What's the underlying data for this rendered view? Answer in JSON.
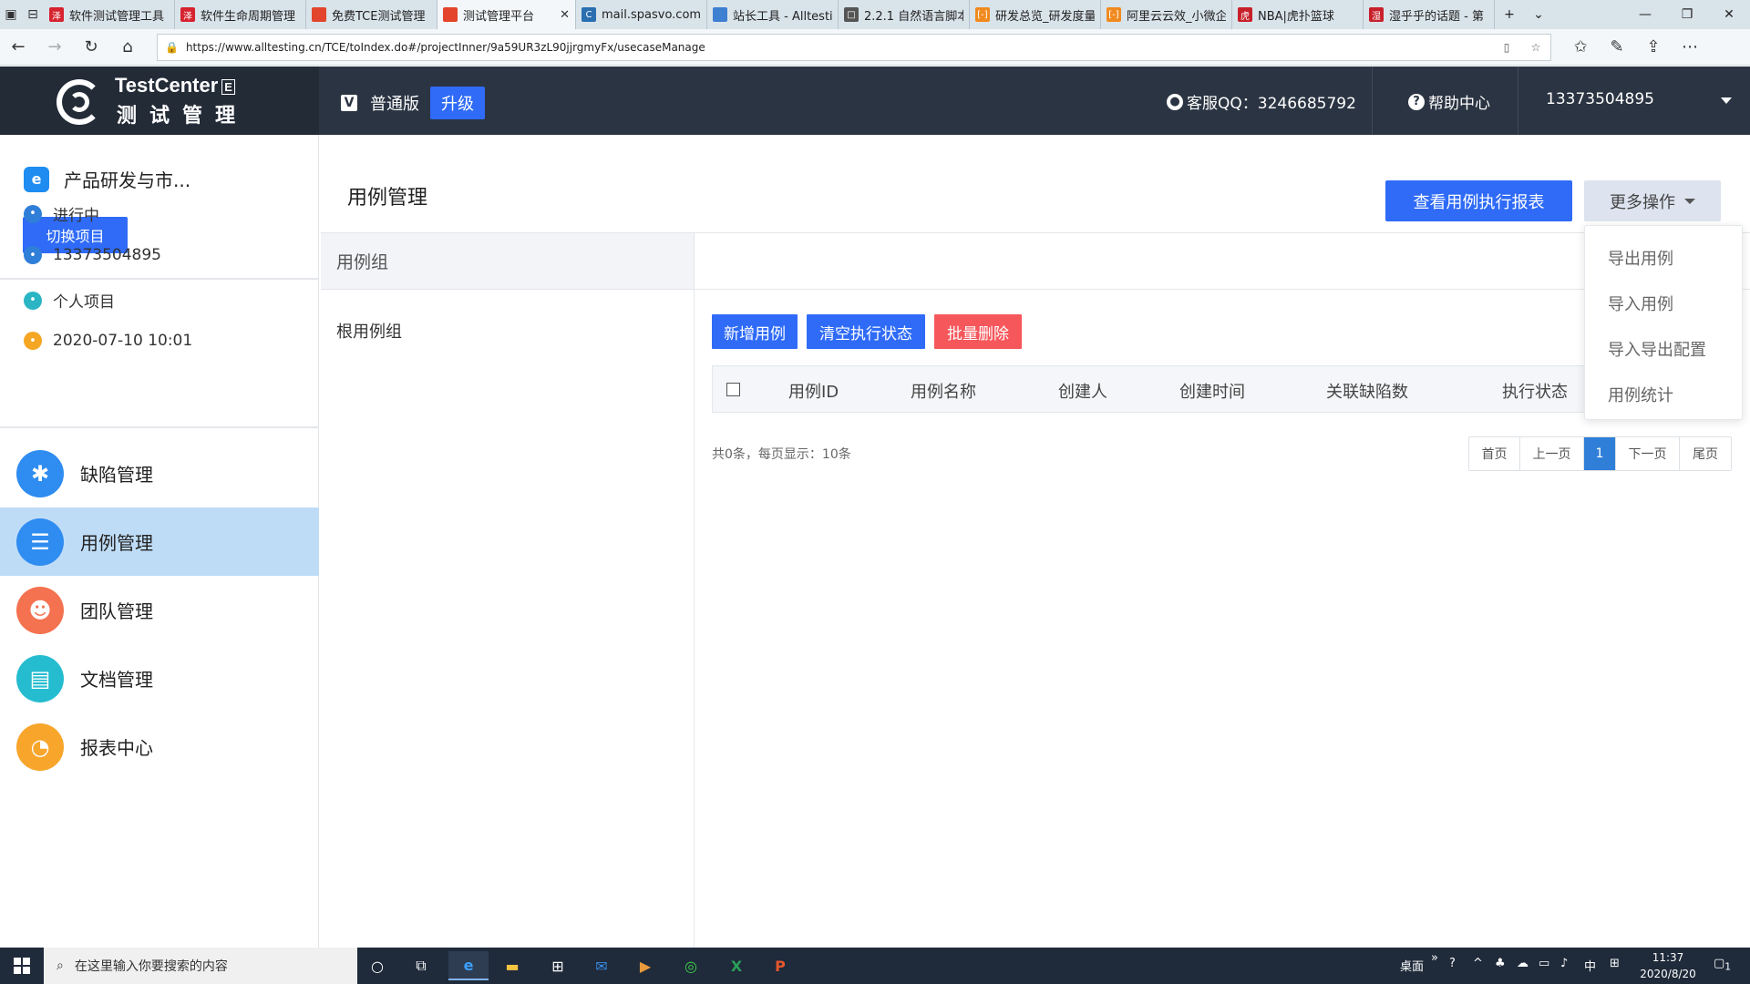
{
  "browser": {
    "tabs": [
      {
        "title": "软件测试管理工具",
        "fav": "泽",
        "color": "#d6232f"
      },
      {
        "title": "软件生命周期管理",
        "fav": "泽",
        "color": "#d6232f"
      },
      {
        "title": "免费TCE测试管理",
        "fav": "",
        "color": "#e2452b"
      },
      {
        "title": "测试管理平台",
        "fav": "",
        "color": "#e2452b",
        "active": true
      },
      {
        "title": "mail.spasvo.com",
        "fav": "C",
        "color": "#2a6fb0"
      },
      {
        "title": "站长工具 - Alltesti",
        "fav": "",
        "color": "#3d7fd1"
      },
      {
        "title": "2.2.1 自然语言脚本",
        "fav": "□",
        "color": "#555555"
      },
      {
        "title": "研发总览_研发度量",
        "fav": "[-]",
        "color": "#f08a1e"
      },
      {
        "title": "阿里云云效_小微企",
        "fav": "[-]",
        "color": "#f08a1e"
      },
      {
        "title": "NBA|虎扑篮球",
        "fav": "虎",
        "color": "#c8202a"
      },
      {
        "title": "湿乎乎的话题 - 第",
        "fav": "湿",
        "color": "#c8202a"
      }
    ],
    "url": "https://www.alltesting.cn/TCE/toIndex.do#/projectInner/9a59UR3zL90jjrgmyFx/usecaseManage"
  },
  "header": {
    "logo_line1": "TestCenter",
    "logo_badge": "E",
    "logo_line2": "测试管理",
    "edition": "普通版",
    "upgrade": "升级",
    "qq": "客服QQ：3246685792",
    "help": "帮助中心",
    "user": "13373504895"
  },
  "sidebar": {
    "project": "产品研发与市...",
    "switch_label": "切换项目",
    "meta": [
      {
        "text": "进行中",
        "icon": "check-circle-icon",
        "color": "#2f7fd8"
      },
      {
        "text": "13373504895",
        "icon": "user-icon",
        "color": "#2f7fd8"
      },
      {
        "text": "个人项目",
        "icon": "grid-icon",
        "color": "#2bb5c4"
      },
      {
        "text": "2020-07-10 10:01",
        "icon": "clock-icon",
        "color": "#f5a623"
      }
    ],
    "menu": [
      {
        "label": "缺陷管理",
        "icon": "bug-icon",
        "color": "#2f8cf0",
        "glyph": "✱"
      },
      {
        "label": "用例管理",
        "icon": "list-icon",
        "color": "#2f8cf0",
        "glyph": "☰",
        "active": true
      },
      {
        "label": "团队管理",
        "icon": "team-icon",
        "color": "#f4724f",
        "glyph": "☻"
      },
      {
        "label": "文档管理",
        "icon": "document-icon",
        "color": "#26bcd0",
        "glyph": "▤"
      },
      {
        "label": "报表中心",
        "icon": "pie-chart-icon",
        "color": "#f7a52b",
        "glyph": "◔"
      }
    ]
  },
  "main": {
    "title": "用例管理",
    "report_btn": "查看用例执行报表",
    "more_btn": "更多操作",
    "group_header": "用例组",
    "root_group": "根用例组",
    "actions": {
      "add": "新增用例",
      "clear": "清空执行状态",
      "delete": "批量删除"
    },
    "columns": [
      "用例ID",
      "用例名称",
      "创建人",
      "创建时间",
      "关联缺陷数",
      "执行状态"
    ],
    "totals": "共0条，每页显示：10条",
    "pager": {
      "first": "首页",
      "prev": "上一页",
      "current": "1",
      "next": "下一页",
      "last": "尾页"
    }
  },
  "dropdown": [
    "导出用例",
    "导入用例",
    "导入导出配置",
    "用例统计"
  ],
  "taskbar": {
    "search_placeholder": "在这里输入你要搜索的内容",
    "desktop": "桌面",
    "ime": "中",
    "time": "11:37",
    "date": "2020/8/20",
    "notif": "1"
  },
  "colors": {
    "primary": "#2f6bf7",
    "danger": "#f5575b",
    "header_bg": "#2b3442",
    "active_menu": "#bfdcf7"
  }
}
